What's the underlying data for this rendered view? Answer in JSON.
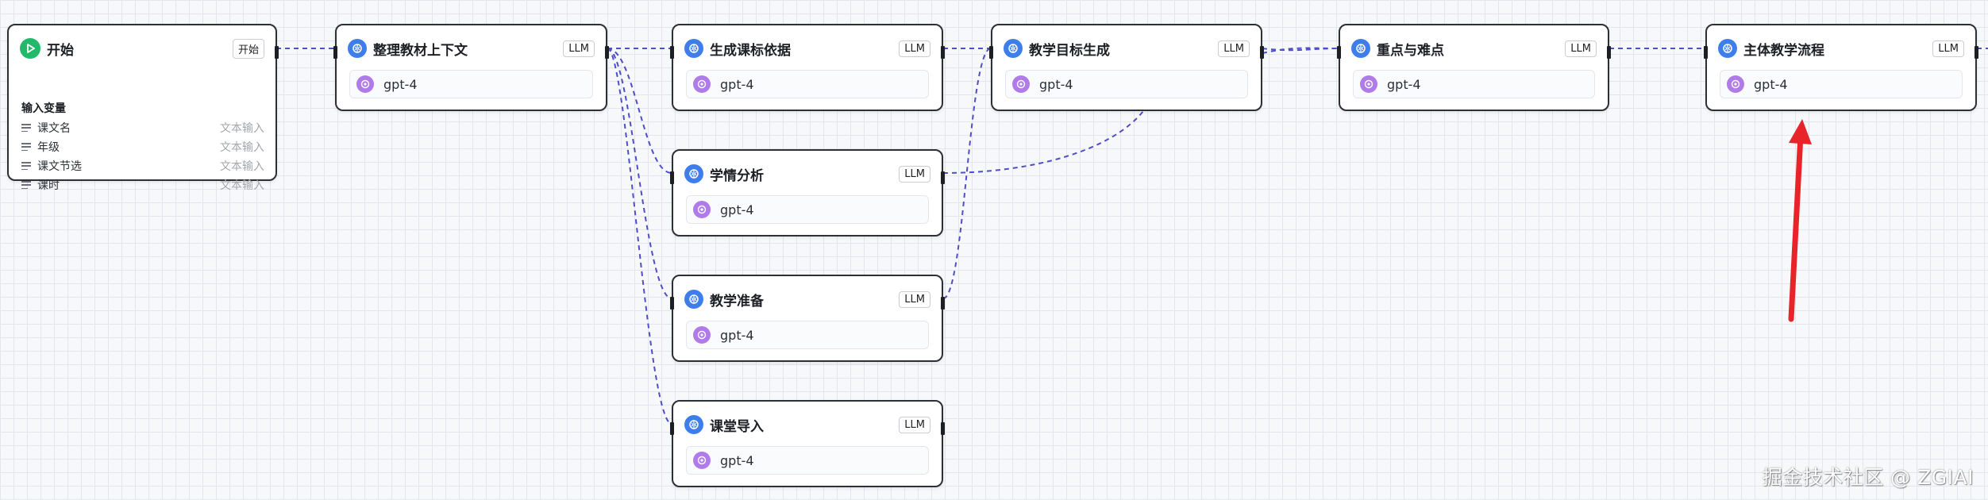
{
  "colors": {
    "edge": "#4e4ec9",
    "arrow": "#e8232a",
    "llm_icon": "#3d7eea",
    "model_icon": "#b07be8",
    "start_icon": "#23b96b"
  },
  "start_node": {
    "title": "开始",
    "badge": "开始",
    "icon": "play-icon",
    "vars_title": "输入变量",
    "vars": [
      {
        "name": "课文名",
        "type": "文本输入"
      },
      {
        "name": "年级",
        "type": "文本输入"
      },
      {
        "name": "课文节选",
        "type": "文本输入"
      },
      {
        "name": "课时",
        "type": "文本输入"
      }
    ]
  },
  "llm_nodes": [
    {
      "id": "organize",
      "title": "整理教材上下文",
      "badge": "LLM",
      "model": "gpt-4"
    },
    {
      "id": "standards",
      "title": "生成课标依据",
      "badge": "LLM",
      "model": "gpt-4"
    },
    {
      "id": "goals",
      "title": "教学目标生成",
      "badge": "LLM",
      "model": "gpt-4"
    },
    {
      "id": "keypoints",
      "title": "重点与难点",
      "badge": "LLM",
      "model": "gpt-4"
    },
    {
      "id": "mainflow",
      "title": "主体教学流程",
      "badge": "LLM",
      "model": "gpt-4"
    },
    {
      "id": "analysis",
      "title": "学情分析",
      "badge": "LLM",
      "model": "gpt-4"
    },
    {
      "id": "prep",
      "title": "教学准备",
      "badge": "LLM",
      "model": "gpt-4"
    },
    {
      "id": "intro",
      "title": "课堂导入",
      "badge": "LLM",
      "model": "gpt-4"
    }
  ],
  "watermark": "掘金技术社区 @ ZGIAI"
}
